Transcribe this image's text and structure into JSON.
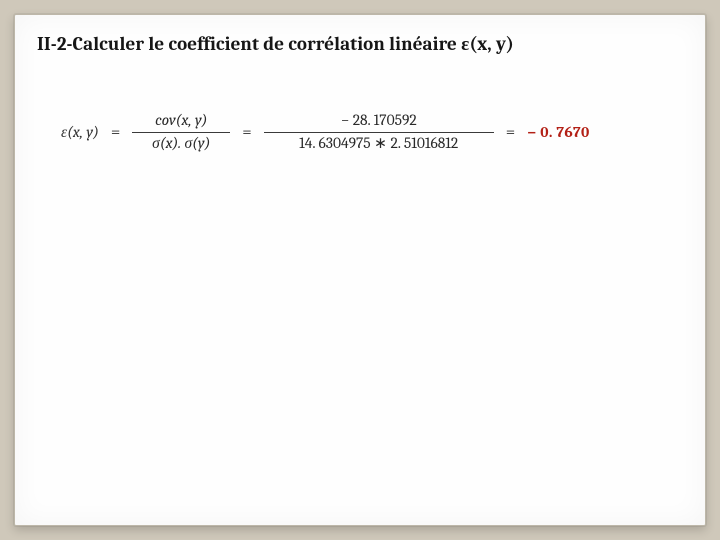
{
  "title": "II-2-Calculer  le coefficient de corrélation linéaire ε(x, y)",
  "equation": {
    "lhs": "ε(x, y)",
    "eq": "=",
    "frac1": {
      "num": "cov(x, y)",
      "den": "σ(x). σ(y)"
    },
    "frac2": {
      "num": "− 28. 170592",
      "den": "14. 6304975 ∗ 2. 51016812"
    },
    "result": "− 0. 7670"
  }
}
